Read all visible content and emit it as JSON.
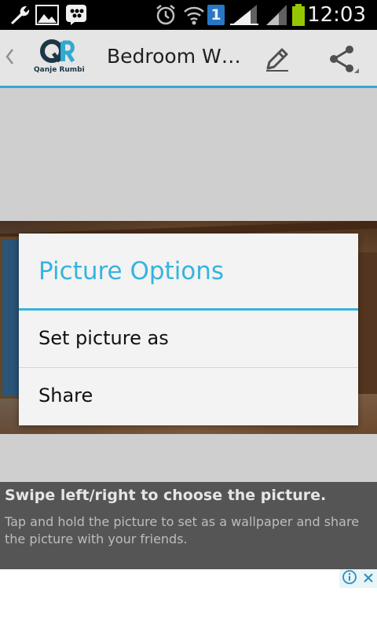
{
  "status_bar": {
    "time": "12:03",
    "notification_count": "1",
    "icons": [
      "wrench-icon",
      "image-icon",
      "bbm-icon",
      "alarm-icon",
      "wifi-icon",
      "signal-icon",
      "signal-icon",
      "battery-icon"
    ]
  },
  "action_bar": {
    "logo_text": "Qanje Rumbi",
    "title": "Bedroom W…",
    "icons": [
      "back-chevron-icon",
      "edit-icon",
      "share-icon"
    ]
  },
  "dialog": {
    "title": "Picture Options",
    "options": [
      "Set picture as",
      "Share"
    ]
  },
  "hint": {
    "title": "Swipe left/right to choose the picture.",
    "text": "Tap and hold the picture to set as a wallpaper and share the picture with your friends."
  },
  "colors": {
    "accent": "#35b4de",
    "status_bar": "#000000",
    "battery": "#9fd400"
  }
}
